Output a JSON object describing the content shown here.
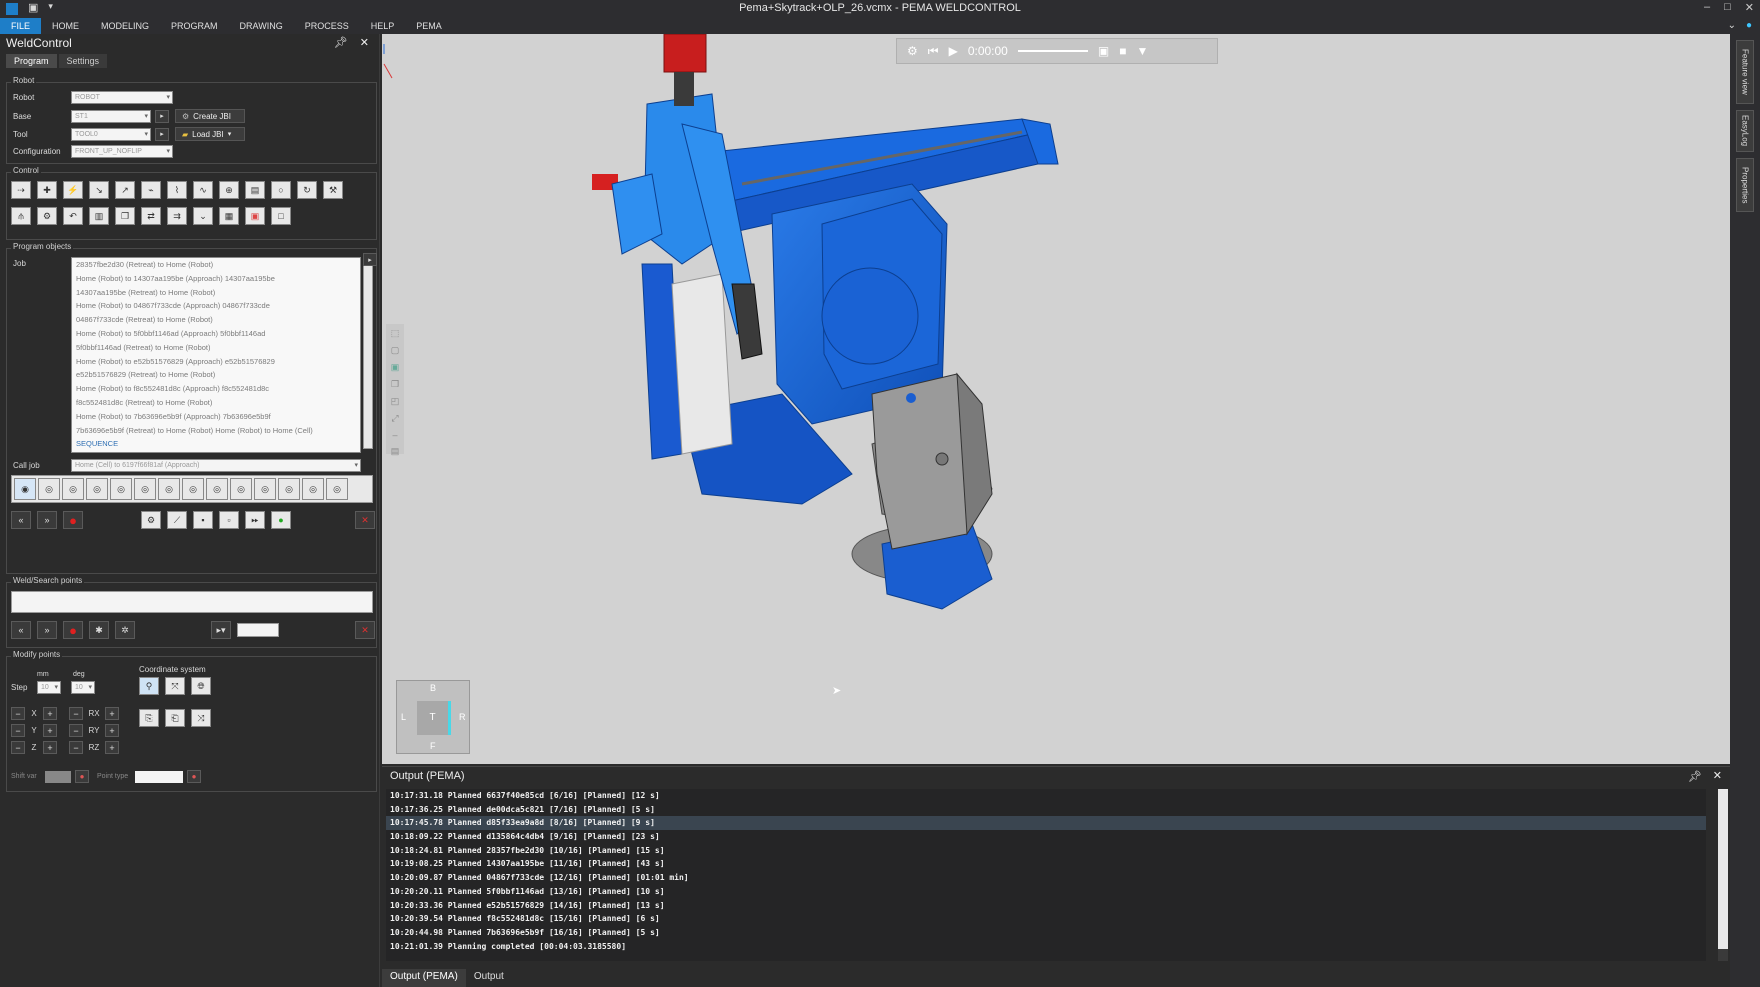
{
  "window": {
    "title": "Pema+Skytrack+OLP_26.vcmx - PEMA WELDCONTROL"
  },
  "ribbon": {
    "tabs": [
      "FILE",
      "HOME",
      "MODELING",
      "PROGRAM",
      "DRAWING",
      "PROCESS",
      "HELP",
      "PEMA"
    ],
    "active": "FILE"
  },
  "weldcontrol": {
    "title": "WeldControl",
    "tabs": [
      "Program",
      "Settings"
    ],
    "robot_group": {
      "title": "Robot",
      "robot_label": "Robot",
      "robot_value": "ROBOT",
      "base_label": "Base",
      "base_value": "ST1",
      "tool_label": "Tool",
      "tool_value": "TOOL0",
      "config_label": "Configuration",
      "config_value": "FRONT_UP_NOFLIP",
      "create_btn": "Create JBI",
      "load_btn": "Load JBI"
    },
    "control_group": {
      "title": "Control"
    },
    "program_objects": {
      "title": "Program objects",
      "job_label": "Job",
      "items": [
        "28357fbe2d30 (Retreat) to Home (Robot)",
        "Home (Robot) to 14307aa195be (Approach)  14307aa195be",
        "14307aa195be (Retreat) to Home (Robot)",
        "Home (Robot) to 04867f733cde (Approach)  04867f733cde",
        "04867f733cde (Retreat) to Home (Robot)",
        "Home (Robot) to 5f0bbf1146ad (Approach)  5f0bbf1146ad",
        "5f0bbf1146ad (Retreat) to Home (Robot)",
        "Home (Robot) to e52b51576829 (Approach)  e52b51576829",
        "e52b51576829 (Retreat) to Home (Robot)",
        "Home (Robot) to f8c552481d8c (Approach)  f8c552481d8c",
        "f8c552481d8c (Retreat) to Home (Robot)",
        "Home (Robot) to 7b63696e5b9f (Approach)  7b63696e5b9f",
        "7b63696e5b9f (Retreat) to Home (Robot)  Home (Robot) to Home (Cell)"
      ],
      "selected_item": "SEQUENCE",
      "call_job_label": "Call job",
      "call_job_value": "Home (Cell) to 6197f66f81af (Approach)"
    },
    "weld_search": {
      "title": "Weld/Search points"
    },
    "modify_points": {
      "title": "Modify points",
      "coord_title": "Coordinate system",
      "step_label": "Step",
      "mm_label": "mm",
      "mm_value": "10",
      "deg_label": "deg",
      "deg_value": "10",
      "axes": [
        "X",
        "Y",
        "Z"
      ],
      "raxes": [
        "RX",
        "RY",
        "RZ"
      ],
      "shift_label": "Shift var",
      "point_type_label": "Point type"
    }
  },
  "viewport": {
    "time": "0:00:00",
    "nav_cube": {
      "top": "B",
      "left": "L",
      "center": "T",
      "right": "R",
      "bottom": "F"
    },
    "colors": {
      "robot": "#1565d8",
      "bg": "#d2d2d2"
    }
  },
  "side_tabs": [
    "Feature view",
    "EasyLog",
    "Properties"
  ],
  "output": {
    "title": "Output (PEMA)",
    "lines": [
      "10:17:31.18 Planned 6637f40e85cd [6/16] [Planned] [12 s]",
      "10:17:36.25 Planned de00dca5c821 [7/16] [Planned] [5 s]",
      "10:17:45.78 Planned d85f33ea9a8d [8/16] [Planned] [9 s]",
      "10:18:09.22 Planned d135864c4db4 [9/16] [Planned] [23 s]",
      "10:18:24.81 Planned 28357fbe2d30 [10/16] [Planned] [15 s]",
      "10:19:08.25 Planned 14307aa195be [11/16] [Planned] [43 s]",
      "10:20:09.87 Planned 04867f733cde [12/16] [Planned] [01:01 min]",
      "10:20:20.11 Planned 5f0bbf1146ad [13/16] [Planned] [10 s]",
      "10:20:33.36 Planned e52b51576829 [14/16] [Planned] [13 s]",
      "10:20:39.54 Planned f8c552481d8c [15/16] [Planned] [6 s]",
      "10:20:44.98 Planned 7b63696e5b9f [16/16] [Planned] [5 s]",
      "10:21:01.39 Planning completed [00:04:03.3185580]"
    ],
    "highlighted_index": 2,
    "tabs": [
      "Output (PEMA)",
      "Output"
    ]
  }
}
